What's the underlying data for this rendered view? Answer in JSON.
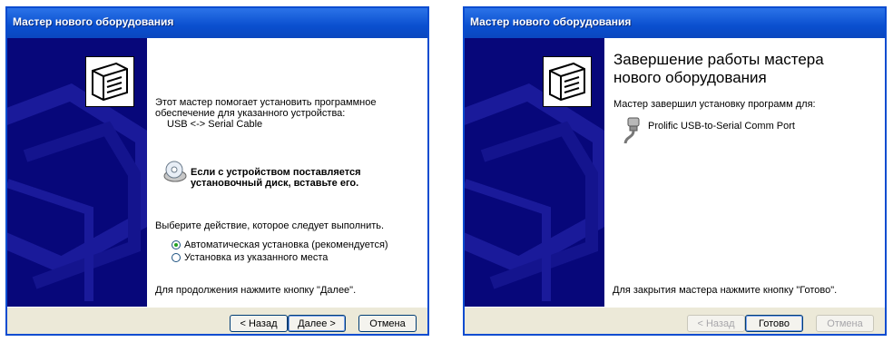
{
  "window1": {
    "title": "Мастер нового оборудования",
    "intro_line1": "Этот мастер помогает установить программное",
    "intro_line2": "обеспечение для указанного устройства:",
    "device_name": "USB <-> Serial Cable",
    "disk_line1": "Если с устройством поставляется",
    "disk_line2": "установочный диск, вставьте его.",
    "choose_action": "Выберите действие, которое следует выполнить.",
    "options": [
      {
        "label": "Автоматическая установка (рекомендуется)",
        "checked": true
      },
      {
        "label": "Установка из указанного места",
        "checked": false
      }
    ],
    "continue_hint": "Для продолжения нажмите кнопку \"Далее\".",
    "buttons": {
      "back": "< Назад",
      "next": "Далее >",
      "cancel": "Отмена"
    }
  },
  "window2": {
    "title": "Мастер нового оборудования",
    "heading_line1": "Завершение работы мастера",
    "heading_line2": "нового оборудования",
    "finished_text": "Мастер завершил установку программ для:",
    "device_name": "Prolific USB-to-Serial Comm Port",
    "close_hint": "Для закрытия мастера нажмите кнопку \"Готово\".",
    "buttons": {
      "back": "< Назад",
      "finish": "Готово",
      "cancel": "Отмена"
    }
  },
  "colors": {
    "titlebar": "#0a4fcf",
    "sidebar": "#07077a",
    "dialog_bg": "#ece9d8",
    "radio_dot": "#21a121"
  }
}
